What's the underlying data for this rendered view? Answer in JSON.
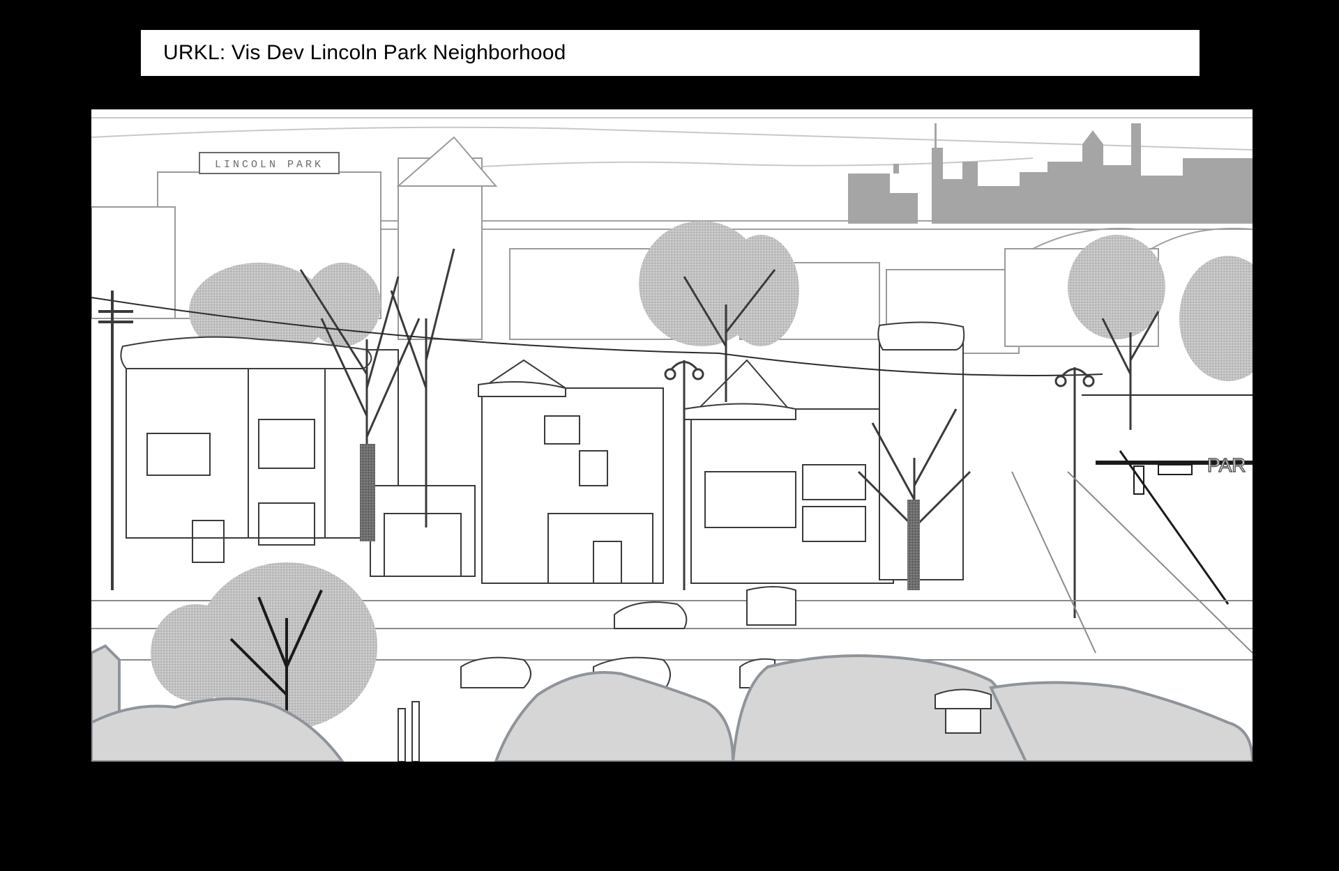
{
  "header": {
    "title": "URKL: Vis Dev Lincoln Park Neighborhood"
  },
  "artwork": {
    "sign_text": "LINCOLN PARK",
    "street_sign_text": "PAR"
  },
  "colors": {
    "background": "#000000",
    "title_bar": "#ffffff",
    "skyline": "#a5a5a5",
    "line_art": "#3a3a3a",
    "snow_shadow": "#d6d6d6"
  }
}
